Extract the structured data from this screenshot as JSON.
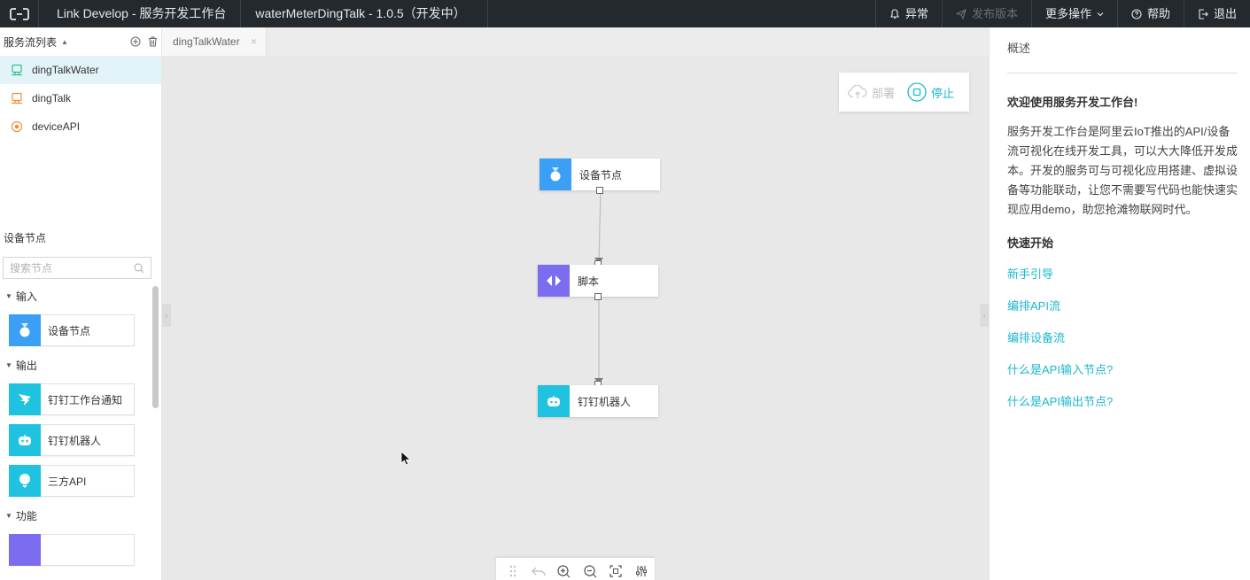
{
  "topbar": {
    "app_title": "Link Develop - 服务开发工作台",
    "project_title": "waterMeterDingTalk - 1.0.5（开发中）",
    "actions": {
      "alarm": "异常",
      "publish": "发布版本",
      "more": "更多操作",
      "help": "帮助",
      "logout": "退出"
    }
  },
  "sidebar": {
    "flow_list_title": "服务流列表",
    "flows": [
      {
        "label": "dingTalkWater",
        "icon": "device-flow-icon",
        "color": "#2fc08b"
      },
      {
        "label": "dingTalk",
        "icon": "device-flow-icon",
        "color": "#f0913a"
      },
      {
        "label": "deviceAPI",
        "icon": "api-flow-icon",
        "color": "#f0913a"
      }
    ],
    "nodes_title": "设备节点",
    "search_placeholder": "搜索节点",
    "categories": [
      {
        "label": "输入",
        "items": [
          {
            "label": "设备节点",
            "icon": "device-node-icon"
          }
        ]
      },
      {
        "label": "输出",
        "items": [
          {
            "label": "钉钉工作台通知",
            "icon": "dingtalk-icon"
          },
          {
            "label": "钉钉机器人",
            "icon": "robot-icon"
          },
          {
            "label": "三方API",
            "icon": "third-party-api-icon"
          }
        ]
      },
      {
        "label": "功能",
        "items": []
      }
    ]
  },
  "tabs": [
    {
      "label": "dingTalkWater",
      "close": "×"
    }
  ],
  "canvas": {
    "deploy_label": "部署",
    "stop_label": "停止",
    "nodes": [
      {
        "label": "设备节点",
        "icon": "device-node-icon",
        "color": "#3a9ff5"
      },
      {
        "label": "脚本",
        "icon": "script-icon",
        "color": "#7b6cf0"
      },
      {
        "label": "钉钉机器人",
        "icon": "robot-icon",
        "color": "#1fc3e0"
      }
    ]
  },
  "right_panel": {
    "overview": "概述",
    "welcome": "欢迎使用服务开发工作台!",
    "description": "服务开发工作台是阿里云IoT推出的API/设备流可视化在线开发工具，可以大大降低开发成本。开发的服务可与可视化应用搭建、虚拟设备等功能联动，让您不需要写代码也能快速实现应用demo，助您抢滩物联网时代。",
    "quick_start": "快速开始",
    "links": [
      "新手引导",
      "编排API流",
      "编排设备流",
      "什么是API输入节点?",
      "什么是API输出节点?"
    ]
  },
  "colors": {
    "accent": "#1ab7d0",
    "topbar": "#24292e",
    "canvas": "#e8e8e8"
  }
}
